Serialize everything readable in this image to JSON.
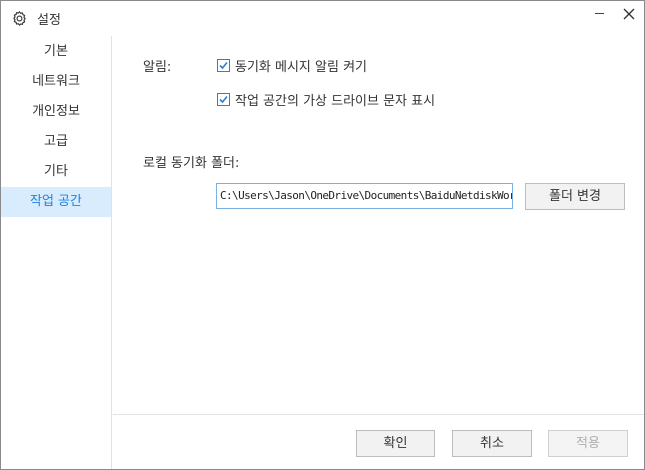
{
  "window": {
    "title": "설정",
    "gear_icon": "gear-icon",
    "minimize_icon": "minimize-icon",
    "close_icon": "close-icon"
  },
  "sidebar": {
    "items": [
      {
        "label": "기본",
        "active": false
      },
      {
        "label": "네트워크",
        "active": false
      },
      {
        "label": "개인정보",
        "active": false
      },
      {
        "label": "고급",
        "active": false
      },
      {
        "label": "기타",
        "active": false
      },
      {
        "label": "작업 공간",
        "active": true
      }
    ]
  },
  "notifications": {
    "label": "알림:",
    "options": [
      {
        "label": "동기화 메시지 알림 켜기",
        "checked": true
      },
      {
        "label": "작업 공간의 가상 드라이브 문자 표시",
        "checked": true
      }
    ]
  },
  "sync_folder": {
    "label": "로컬 동기화 폴더:",
    "path": "C:\\Users\\Jason\\OneDrive\\Documents\\BaiduNetdiskWor",
    "change_button": "폴더 변경"
  },
  "footer": {
    "ok_button": "확인",
    "cancel_button": "취소",
    "apply_button": "적용"
  },
  "colors": {
    "accent": "#1a85e6",
    "active_bg": "#d9ecfd",
    "checkbox": "#2a7fd6"
  }
}
